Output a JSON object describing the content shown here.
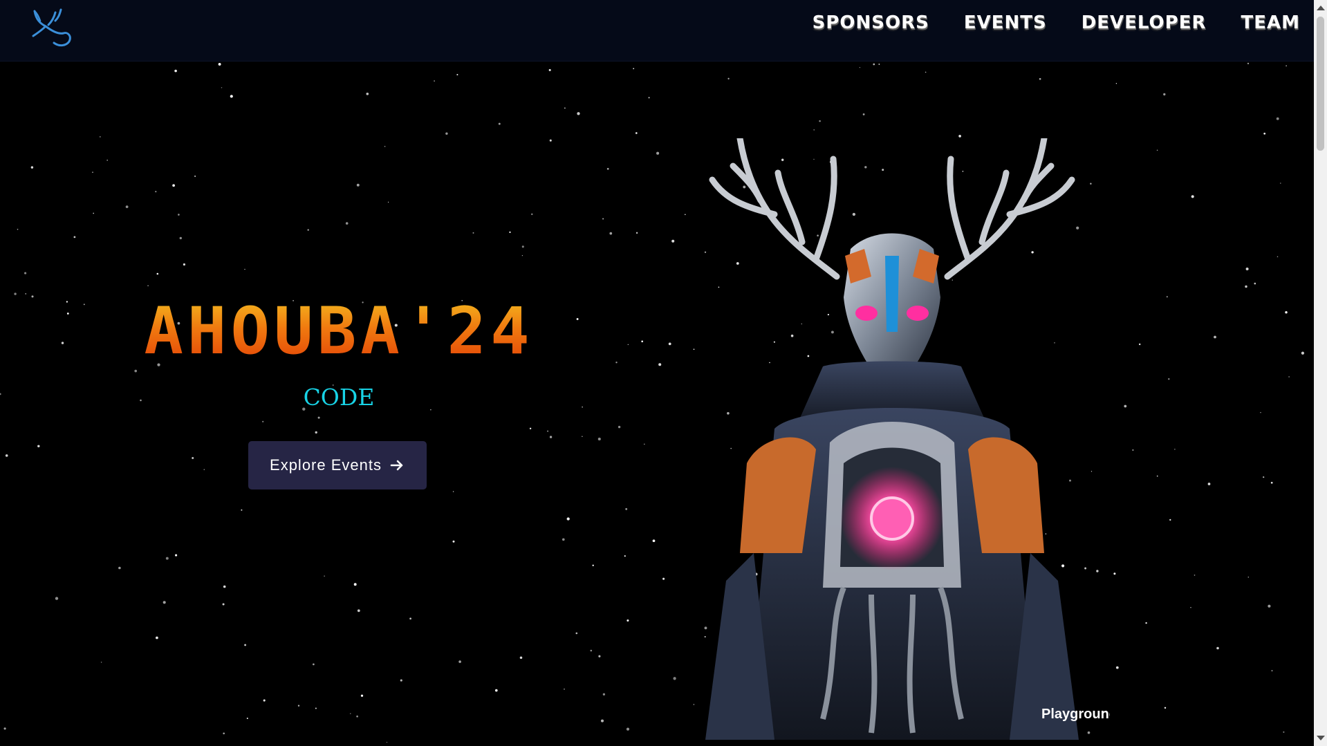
{
  "nav": {
    "logo_icon": "deer-antler-logo-icon",
    "links": [
      {
        "label": "SPONSORS"
      },
      {
        "label": "EVENTS"
      },
      {
        "label": "DEVELOPER"
      },
      {
        "label": "TEAM"
      }
    ]
  },
  "hero": {
    "title": "AHOUBA'24",
    "subtitle": "CODE",
    "cta_label": "Explore Events",
    "cta_icon": "arrow-right-icon",
    "mascot": "robotic-deer-mascot",
    "watermark": "Playground"
  },
  "colors": {
    "navbar_bg": "#050a18",
    "page_bg": "#000000",
    "title_gradient": [
      "#f4c021",
      "#f07a10",
      "#e23d05"
    ],
    "subtitle": "#18d3e6",
    "button_bg": "#262545",
    "logo": "#3b8fd9"
  }
}
